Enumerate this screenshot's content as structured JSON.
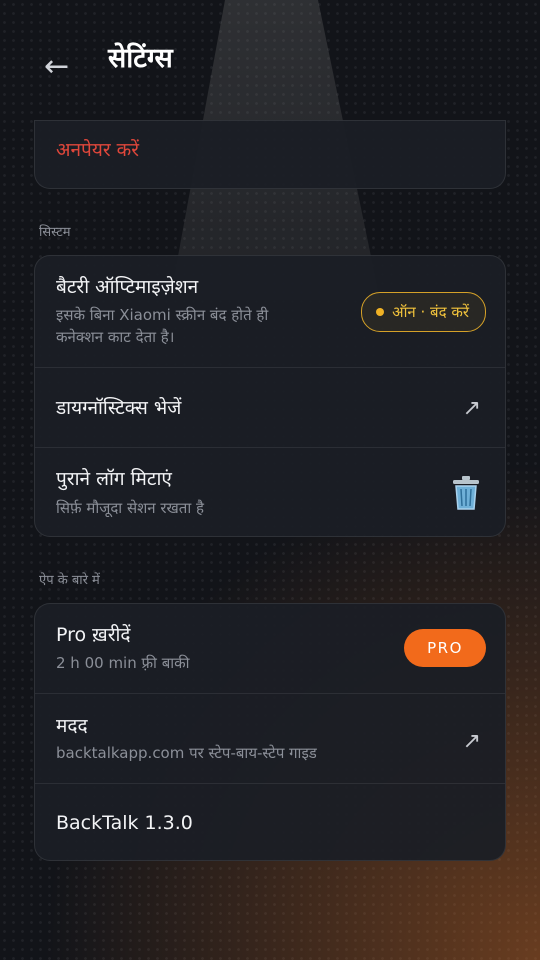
{
  "header": {
    "back_icon": "arrow-left-icon",
    "title": "सेटिंग्स"
  },
  "unpair_card": {
    "label": "अनपेयर करें",
    "color": "#e0473b"
  },
  "system_section": {
    "title": "सिस्टम",
    "battery": {
      "title": "बैटरी ऑप्टिमाइज़ेशन",
      "subtitle_line1": "इसके बिना Xiaomi स्क्रीन बंद होते ही",
      "subtitle_line2": "कनेक्शन काट देता है।",
      "badge": "ऑन · बंद करें",
      "badge_color": "#d5a128"
    },
    "diagnostics": {
      "title": "डायग्नॉस्टिक्स भेजें",
      "icon": "external-arrow-icon"
    },
    "clear_logs": {
      "title": "पुराने लॉग मिटाएं",
      "subtitle": "सिर्फ़ मौजूदा सेशन रखता है",
      "icon": "trash-icon"
    }
  },
  "about_section": {
    "title": "ऐप के बारे में",
    "pro": {
      "title": "Pro ख़रीदें",
      "subtitle": "2 h 00 min फ़्री बाकी",
      "badge": "PRO",
      "badge_color": "#f26a1b"
    },
    "help": {
      "title": "मदद",
      "subtitle": "backtalkapp.com पर स्टेप-बाय-स्टेप गाइड",
      "icon": "external-arrow-icon"
    },
    "version": {
      "title": "BackTalk 1.3.0"
    }
  }
}
